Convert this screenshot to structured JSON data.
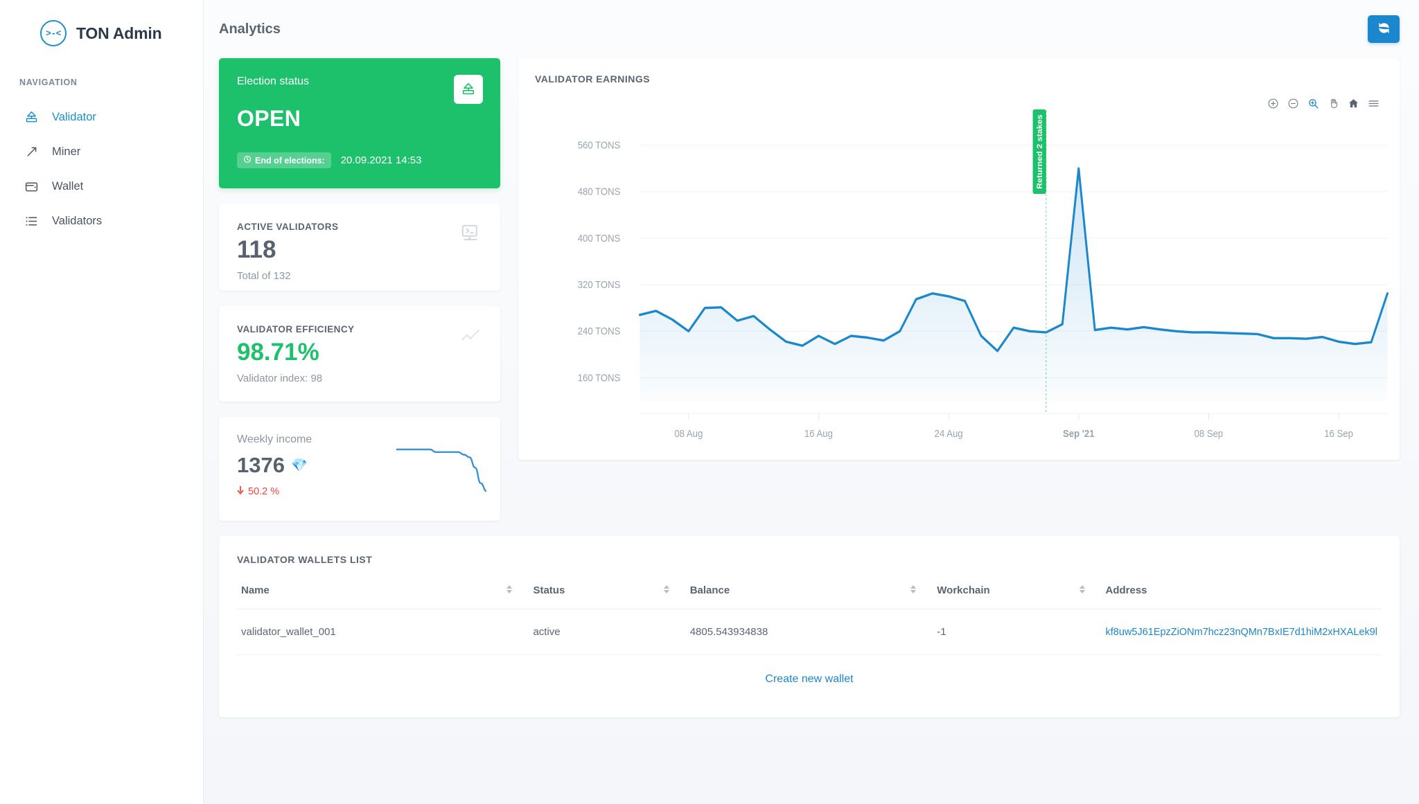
{
  "brand": {
    "title": "TON Admin",
    "logo_glyph": ">-<"
  },
  "sidebar": {
    "nav_heading": "NAVIGATION",
    "items": [
      {
        "label": "Validator",
        "icon": "validator-icon",
        "active": true
      },
      {
        "label": "Miner",
        "icon": "pickaxe-icon",
        "active": false
      },
      {
        "label": "Wallet",
        "icon": "wallet-icon",
        "active": false
      },
      {
        "label": "Validators",
        "icon": "list-icon",
        "active": false
      }
    ]
  },
  "topbar": {
    "title": "Analytics",
    "refresh_icon": "refresh-icon"
  },
  "election": {
    "label": "Election status",
    "value": "OPEN",
    "badge_label": "End of elections:",
    "date": "20.09.2021 14:53",
    "icon": "election-box-icon",
    "accent": "#1ec16b"
  },
  "active_validators": {
    "label": "ACTIVE VALIDATORS",
    "value": "118",
    "sub": "Total of 132",
    "icon": "terminal-monitor-icon"
  },
  "efficiency": {
    "label": "VALIDATOR EFFICIENCY",
    "value": "98.71%",
    "sub": "Validator index: 98",
    "icon": "trend-line-icon",
    "color": "#1ec16b"
  },
  "weekly_income": {
    "label": "Weekly income",
    "value": "1376",
    "gem": "💎",
    "delta": "50.2 %",
    "delta_direction": "down",
    "delta_color": "#f4443c",
    "spark_values": [
      18,
      18,
      18,
      18,
      18,
      18,
      18,
      17,
      17,
      17,
      17,
      17,
      16,
      15,
      11,
      5,
      2
    ]
  },
  "chart_panel": {
    "title": "VALIDATOR EARNINGS",
    "toolbar": [
      {
        "name": "zoom-in-icon",
        "label": "Zoom In"
      },
      {
        "name": "zoom-out-icon",
        "label": "Zoom Out"
      },
      {
        "name": "selection-zoom-icon",
        "label": "Selection Zoom",
        "active": true
      },
      {
        "name": "pan-icon",
        "label": "Panning"
      },
      {
        "name": "home-icon",
        "label": "Reset Zoom"
      },
      {
        "name": "menu-icon",
        "label": "Menu"
      }
    ]
  },
  "chart_data": {
    "type": "area",
    "title": "VALIDATOR EARNINGS",
    "xlabel": "",
    "ylabel": "TONS",
    "ylim": [
      120,
      600
    ],
    "yticks": [
      160,
      240,
      320,
      400,
      480,
      560
    ],
    "ytick_labels": [
      "160 TONS",
      "240 TONS",
      "320 TONS",
      "400 TONS",
      "480 TONS",
      "560 TONS"
    ],
    "xtick_labels": [
      "08 Aug",
      "16 Aug",
      "24 Aug",
      "Sep '21",
      "08 Sep",
      "16 Sep"
    ],
    "xtick_positions": [
      3,
      11,
      19,
      27,
      35,
      43
    ],
    "grid": true,
    "legend": false,
    "line_color": "#1b87cc",
    "fill_color": "#1b87cc",
    "annotation": {
      "label": "Returned 2 stakes",
      "x_index": 25,
      "color": "#1ec16b"
    },
    "series": [
      {
        "name": "Validator earnings",
        "x": [
          "03 Aug",
          "04 Aug",
          "05 Aug",
          "06 Aug",
          "07 Aug",
          "08 Aug",
          "09 Aug",
          "10 Aug",
          "11 Aug",
          "12 Aug",
          "13 Aug",
          "14 Aug",
          "15 Aug",
          "16 Aug",
          "17 Aug",
          "18 Aug",
          "19 Aug",
          "20 Aug",
          "21 Aug",
          "22 Aug",
          "23 Aug",
          "24 Aug",
          "25 Aug",
          "26 Aug",
          "27 Aug",
          "28 Aug",
          "29 Aug",
          "30 Aug",
          "31 Aug",
          "01 Sep",
          "02 Sep",
          "03 Sep",
          "04 Sep",
          "05 Sep",
          "06 Sep",
          "07 Sep",
          "08 Sep",
          "09 Sep",
          "10 Sep",
          "11 Sep",
          "12 Sep",
          "13 Sep",
          "14 Sep",
          "15 Sep",
          "16 Sep",
          "17 Sep",
          "18 Sep"
        ],
        "values": [
          268,
          275,
          260,
          240,
          280,
          281,
          258,
          266,
          243,
          222,
          215,
          232,
          218,
          232,
          229,
          224,
          240,
          295,
          305,
          300,
          292,
          232,
          206,
          246,
          240,
          238,
          252,
          520,
          242,
          246,
          243,
          247,
          243,
          240,
          238,
          238,
          237,
          236,
          235,
          228,
          228,
          227,
          230,
          222,
          218,
          221,
          305
        ]
      }
    ]
  },
  "wallets": {
    "title": "VALIDATOR WALLETS LIST",
    "columns": [
      {
        "label": "Name",
        "sortable": true
      },
      {
        "label": "Status",
        "sortable": true
      },
      {
        "label": "Balance",
        "sortable": true
      },
      {
        "label": "Workchain",
        "sortable": true
      },
      {
        "label": "Address",
        "sortable": false
      }
    ],
    "rows": [
      {
        "name": "validator_wallet_001",
        "status": "active",
        "balance": "4805.543934838",
        "workchain": "-1",
        "address": "kf8uw5J61EpzZiONm7hcz23nQMn7BxIE7d1hiM2xHXALek9l"
      }
    ],
    "create_link": "Create new wallet"
  }
}
